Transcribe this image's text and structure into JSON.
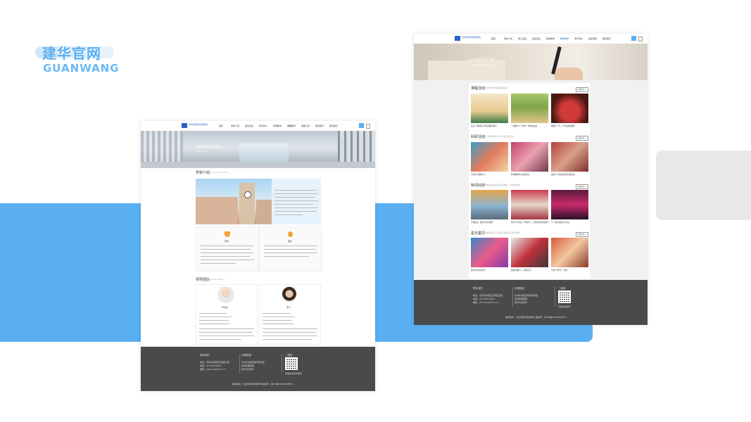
{
  "brand": {
    "title_cn": "建华官网",
    "title_en": "GUANWANG"
  },
  "left_page": {
    "nav": [
      "首页",
      "学校介绍",
      "招生就业",
      "新闻中心",
      "科研教学",
      "课程教学",
      "党团工作",
      "联系我们",
      "联系我们"
    ],
    "hero": {
      "title": "北京市建华实验学校",
      "subtitle": "ABOUT US"
    },
    "about": {
      "title": "学校介绍",
      "sub": "School introduction"
    },
    "about_card_1": {
      "label": "荣誉"
    },
    "about_card_2": {
      "label": "理念"
    },
    "team": {
      "title": "领导团队",
      "sub": "School leaders"
    },
    "leader_1": {
      "name": "李金初"
    },
    "leader_2": {
      "name": "李涛"
    },
    "footer": {
      "col1_title": "联系我们",
      "col1_lines": [
        "地址：北京市海淀区玉海园五里",
        "电话：010-88776543",
        "邮箱：jhxlxiao@163.com"
      ],
      "col2_title": "友情链接",
      "col2_lines": [
        "北京市海淀区教育委员会",
        "建华集团官网",
        "建华文化教育"
      ],
      "col3_title": "二维码",
      "col3_caption": "扫描关注建华官方",
      "copyright": "版权所有：北京市建华实验学校  备案号：京ICP备17008949号-1"
    }
  },
  "right_page": {
    "nav": [
      "首页",
      "学校介绍",
      "党工建设",
      "招生就业",
      "新闻教学",
      "教育教学",
      "学术专栏",
      "招生招聘",
      "联系我们"
    ],
    "hero": {
      "title": "北京市建华实验学校",
      "subtitle": "Education and learning"
    },
    "sections": [
      {
        "title": "课程活动",
        "sub": "特色学科与课程活动动态",
        "more": "查看更多 >",
        "captions": [
          "又是一年重阳日 隆冬情暖 敬老下",
          "一种面什么 学生在一群丝毫改变",
          "我编写一件，小学完成的观察"
        ]
      },
      {
        "title": "科研活动",
        "sub": "教一体科研教育与大学科学活动",
        "more": "查看更多 >",
        "captions": [
          "学生参与课程学习",
          "外地教师研讨交流活动",
          "观察几个项目的情况实践活动"
        ]
      },
      {
        "title": "新闻动态",
        "sub": "学校最新新闻资讯和通知，学校的活动",
        "more": "查看更多 >",
        "captions": [
          "学校运动，像在学生的课程",
          "新年学习活动，学校学习，全校师生参加的年会",
          "千一般学项目中心活动"
        ]
      },
      {
        "title": "星光童贝",
        "sub": "记录学校孩子们的点滴成长与快乐童年",
        "more": "查看更多 >",
        "captions": [
          "童年时光里的欢乐",
          "展现自我学习，展现艺术",
          "学校少年才艺，展示"
        ]
      }
    ],
    "footer": {
      "col1_title": "联系我们",
      "col1_lines": [
        "地址：北京市海淀区玉海园五里",
        "电话：010-88776543",
        "邮箱：jhxlxiao@163.com"
      ],
      "col2_title": "友情链接",
      "col2_lines": [
        "北京市海淀区教育委员会",
        "建华集团官网",
        "建华文化教育"
      ],
      "col3_title": "二维码",
      "col3_caption": "扫描关注建华",
      "copyright": "版权所有：北京市建华实验学校  备案号：京ICP备17008949号-1"
    }
  }
}
